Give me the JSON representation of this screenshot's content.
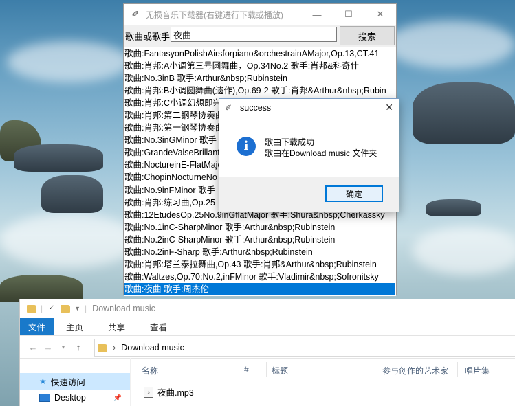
{
  "main_window": {
    "title": "无损音乐下载器(右键进行下载或播放)",
    "icon": "feather-icon",
    "controls": {
      "minimize": "—",
      "maximize": "☐",
      "close": "✕"
    },
    "search_label": "歌曲或歌手",
    "search_value": "夜曲",
    "search_button": "搜索",
    "results": [
      "歌曲:FantasyonPolishAirsforpiano&orchestrainAMajor,Op.13,CT.41",
      "歌曲:肖邦:A小调第三号圆舞曲，Op.34No.2  歌手:肖邦&科奇什",
      "歌曲:No.3inB  歌手:Arthur&nbsp;Rubinstein",
      "歌曲:肖邦:B小调圆舞曲(遗作),Op.69-2  歌手:肖邦&Arthur&nbsp;Rubin",
      "歌曲:肖邦:C小调幻想即兴曲Op.66",
      "歌曲:肖邦:第二钢琴协奏曲",
      "歌曲:肖邦:第一钢琴协奏曲",
      "歌曲:No.3inGMinor  歌手",
      "歌曲:GrandeValseBrillante",
      "歌曲:NoctureinE-FlatMajor",
      "歌曲:ChopinNocturneNo",
      "歌曲:No.9inFMinor  歌手",
      "歌曲:肖邦:练习曲,Op.25",
      "歌曲:12EtudesOp.25No.9inGflatMajor  歌手:Shura&nbsp;Cherkassky",
      "歌曲:No.1inC-SharpMinor  歌手:Arthur&nbsp;Rubinstein",
      "歌曲:No.2inC-SharpMinor  歌手:Arthur&nbsp;Rubinstein",
      "歌曲:No.2inF-Sharp  歌手:Arthur&nbsp;Rubinstein",
      "歌曲:肖邦:塔兰泰拉舞曲,Op.43  歌手:肖邦&Arthur&nbsp;Rubinstein",
      "歌曲:Waltzes,Op.70:No.2,inFMinor  歌手:Vladimir&nbsp;Sofronitsky",
      "歌曲:夜曲  歌手:周杰伦"
    ],
    "selected_index": 19
  },
  "dialog": {
    "title": "success",
    "icon": "info-icon",
    "line1": "歌曲下载成功",
    "line2": "歌曲在Download music 文件夹",
    "ok_label": "确定",
    "close": "✕"
  },
  "explorer": {
    "title": "Download music",
    "tabs": [
      "文件",
      "主页",
      "共享",
      "查看"
    ],
    "path": "Download music",
    "sidebar": [
      "快速访问",
      "Desktop"
    ],
    "columns": [
      "名称",
      "#",
      "标题",
      "参与创作的艺术家",
      "唱片集"
    ],
    "files": [
      "夜曲.mp3"
    ]
  },
  "colors": {
    "selection": "#0078d7",
    "ribbon_file": "#1979ca"
  }
}
